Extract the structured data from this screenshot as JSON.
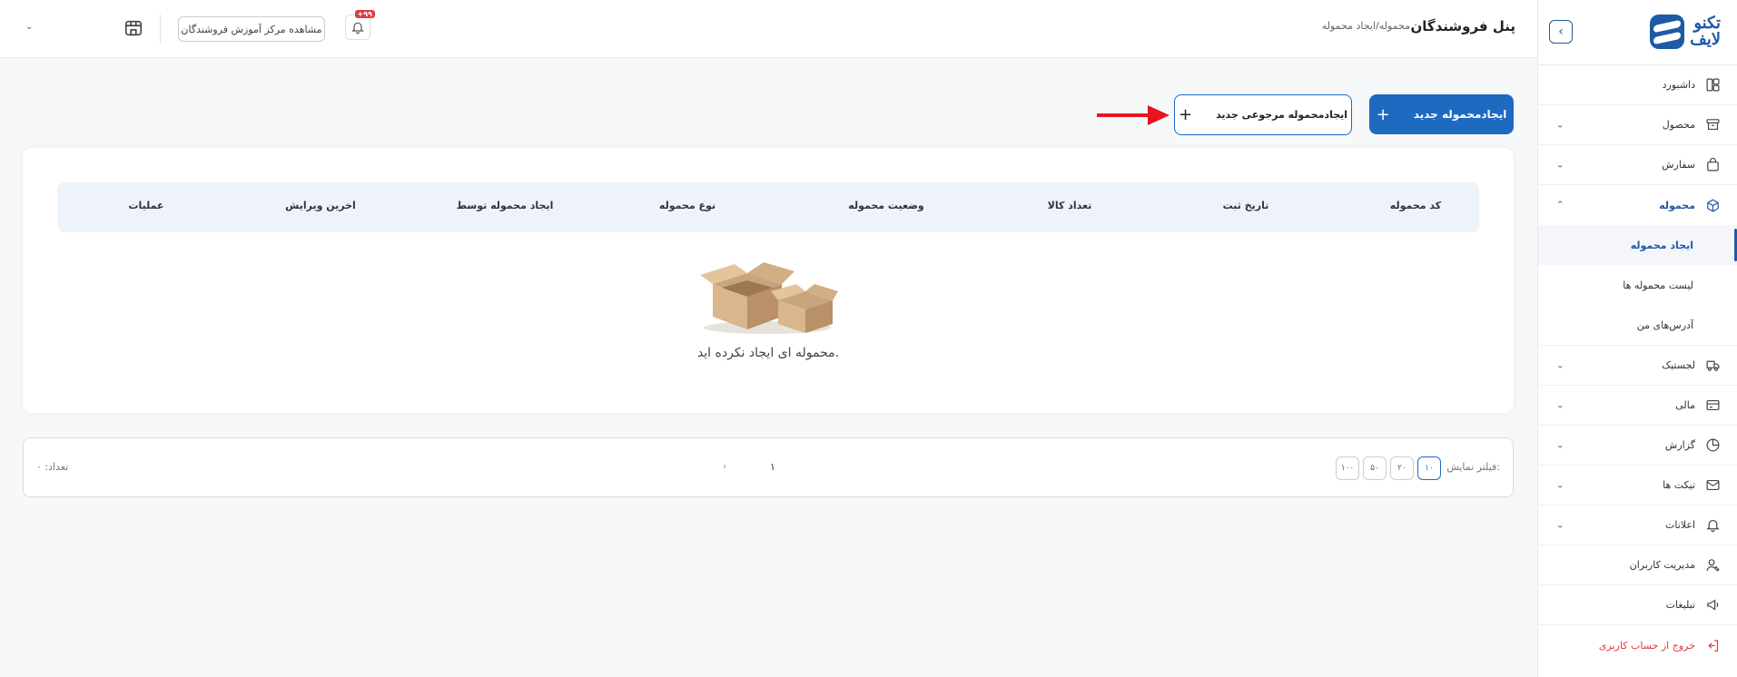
{
  "brand": {
    "logo_text_1": "تکنو",
    "logo_text_2": "لایف"
  },
  "header": {
    "panel_title": "پنل فروشندگان",
    "breadcrumb": "محموله/ایجاد محموله",
    "notification_badge": "+۹۹",
    "training_button": "مشاهده مرکز آموزش فروشندگان"
  },
  "sidebar": {
    "items": [
      {
        "label": "داشبورد",
        "icon": "dashboard-icon"
      },
      {
        "label": "محصول",
        "icon": "box-icon"
      },
      {
        "label": "سفارش",
        "icon": "bag-icon"
      },
      {
        "label": "محموله",
        "icon": "package-icon"
      },
      {
        "label": "لجستیک",
        "icon": "truck-icon"
      },
      {
        "label": "مالی",
        "icon": "card-icon"
      },
      {
        "label": "گزارش",
        "icon": "chart-icon"
      },
      {
        "label": "تیکت ها",
        "icon": "ticket-icon"
      },
      {
        "label": "اعلانات",
        "icon": "bell-icon"
      },
      {
        "label": "مدیریت کاربران",
        "icon": "user-icon"
      },
      {
        "label": "تبلیغات",
        "icon": "megaphone-icon"
      },
      {
        "label": "خروج از حساب کاربری",
        "icon": "logout-icon"
      }
    ],
    "subitems": [
      {
        "label": "ایجاد محموله"
      },
      {
        "label": "لیست محموله ها"
      },
      {
        "label": "آدرس‌های من"
      }
    ]
  },
  "actions": {
    "create_shipment": "ایجادمحموله جدید",
    "create_return_shipment": "ایجادمحموله مرجوعی جدید"
  },
  "table": {
    "columns": [
      "کد محموله",
      "تاریخ ثبت",
      "تعداد کالا",
      "وضعیت محموله",
      "نوع محموله",
      "ایجاد محموله توسط",
      "اخرین ویرایش",
      "عملیات"
    ],
    "empty_message": "محموله ای ایجاد نکرده اید."
  },
  "pagination": {
    "filter_label": "فیلتر نمایش:",
    "page_sizes": [
      "۱۰",
      "۲۰",
      "۵۰",
      "۱۰۰"
    ],
    "selected_size": "۱۰",
    "current_page": "۱",
    "count_label": "تعداد: ۰"
  },
  "colors": {
    "primary": "#1e6ac1",
    "danger": "#e0393e"
  }
}
